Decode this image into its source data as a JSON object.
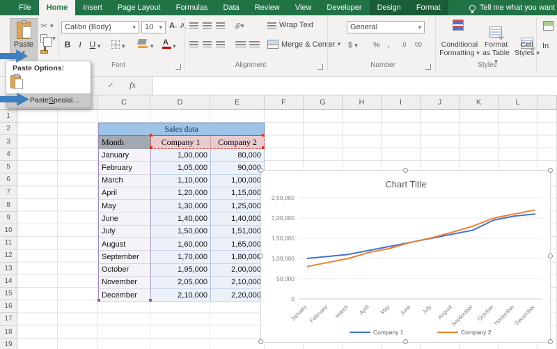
{
  "ribbon": {
    "tabs": [
      {
        "label": "File",
        "active": false,
        "contextual": false
      },
      {
        "label": "Home",
        "active": true,
        "contextual": false
      },
      {
        "label": "Insert",
        "active": false,
        "contextual": false
      },
      {
        "label": "Page Layout",
        "active": false,
        "contextual": false
      },
      {
        "label": "Formulas",
        "active": false,
        "contextual": false
      },
      {
        "label": "Data",
        "active": false,
        "contextual": false
      },
      {
        "label": "Review",
        "active": false,
        "contextual": false
      },
      {
        "label": "View",
        "active": false,
        "contextual": false
      },
      {
        "label": "Developer",
        "active": false,
        "contextual": false
      },
      {
        "label": "Design",
        "active": false,
        "contextual": true
      },
      {
        "label": "Format",
        "active": false,
        "contextual": true
      }
    ],
    "search_label": "Tell me what you want t",
    "clipboard": {
      "paste_label": "Paste"
    },
    "font": {
      "font_name": "Calibri (Body)",
      "font_size": "10",
      "bold": "B",
      "italic": "I",
      "underline": "U",
      "group_label": "Font"
    },
    "alignment": {
      "wrap_text": "Wrap Text",
      "merge_center": "Merge & Center",
      "orientation": "ab",
      "group_label": "Alignment"
    },
    "number": {
      "format": "General",
      "currency": "$",
      "percent": "%",
      "comma": ",",
      "inc_decimal": ".0",
      "dec_decimal": "00",
      "group_label": "Number"
    },
    "styles": {
      "conditional": "Conditional Formatting",
      "format_table": "Format as Table",
      "cell_styles": "Cell Styles",
      "group_label": "Styles"
    },
    "insert_partial": "In"
  },
  "icons": {
    "dropdown": "▾",
    "cut": "✂",
    "cancel": "×",
    "enter": "✓",
    "fx": "fx"
  },
  "paste_menu": {
    "title": "Paste Options:",
    "item_prefix": "Paste ",
    "item_accel": "S",
    "item_suffix": "pecial…"
  },
  "sheet": {
    "columns": [
      "",
      "",
      "C",
      "D",
      "E",
      "F",
      "G",
      "H",
      "I",
      "J",
      "K",
      "L",
      ""
    ],
    "row_count": 19
  },
  "table": {
    "title": "Sales data",
    "headers": [
      "Month",
      "Company 1",
      "Company 2"
    ],
    "rows": [
      [
        "January",
        "1,00,000",
        "80,000"
      ],
      [
        "February",
        "1,05,000",
        "90,000"
      ],
      [
        "March",
        "1,10,000",
        "1,00,000"
      ],
      [
        "April",
        "1,20,000",
        "1,15,000"
      ],
      [
        "May",
        "1,30,000",
        "1,25,000"
      ],
      [
        "June",
        "1,40,000",
        "1,40,000"
      ],
      [
        "July",
        "1,50,000",
        "1,51,000"
      ],
      [
        "August",
        "1,60,000",
        "1,65,000"
      ],
      [
        "September",
        "1,70,000",
        "1,80,000"
      ],
      [
        "October",
        "1,95,000",
        "2,00,000"
      ],
      [
        "November",
        "2,05,000",
        "2,10,000"
      ],
      [
        "December",
        "2,10,000",
        "2,20,000"
      ]
    ]
  },
  "chart_data": {
    "type": "line",
    "title": "Chart Title",
    "categories": [
      "January",
      "February",
      "March",
      "April",
      "May",
      "June",
      "July",
      "August",
      "September",
      "October",
      "November",
      "December"
    ],
    "series": [
      {
        "name": "Company 1",
        "color": "#4472C4",
        "values": [
          100000,
          105000,
          110000,
          120000,
          130000,
          140000,
          150000,
          160000,
          170000,
          195000,
          205000,
          210000
        ]
      },
      {
        "name": "Company 2",
        "color": "#ED7D31",
        "values": [
          80000,
          90000,
          100000,
          115000,
          125000,
          140000,
          151000,
          165000,
          180000,
          200000,
          210000,
          220000
        ]
      }
    ],
    "y_ticks": [
      "0",
      "50,000",
      "1,00,000",
      "1,50,000",
      "2,00,000",
      "2,50,000"
    ],
    "y_tick_values": [
      0,
      50000,
      100000,
      150000,
      200000,
      250000
    ],
    "ylim": [
      0,
      250000
    ],
    "grid": true,
    "legend_position": "bottom"
  }
}
